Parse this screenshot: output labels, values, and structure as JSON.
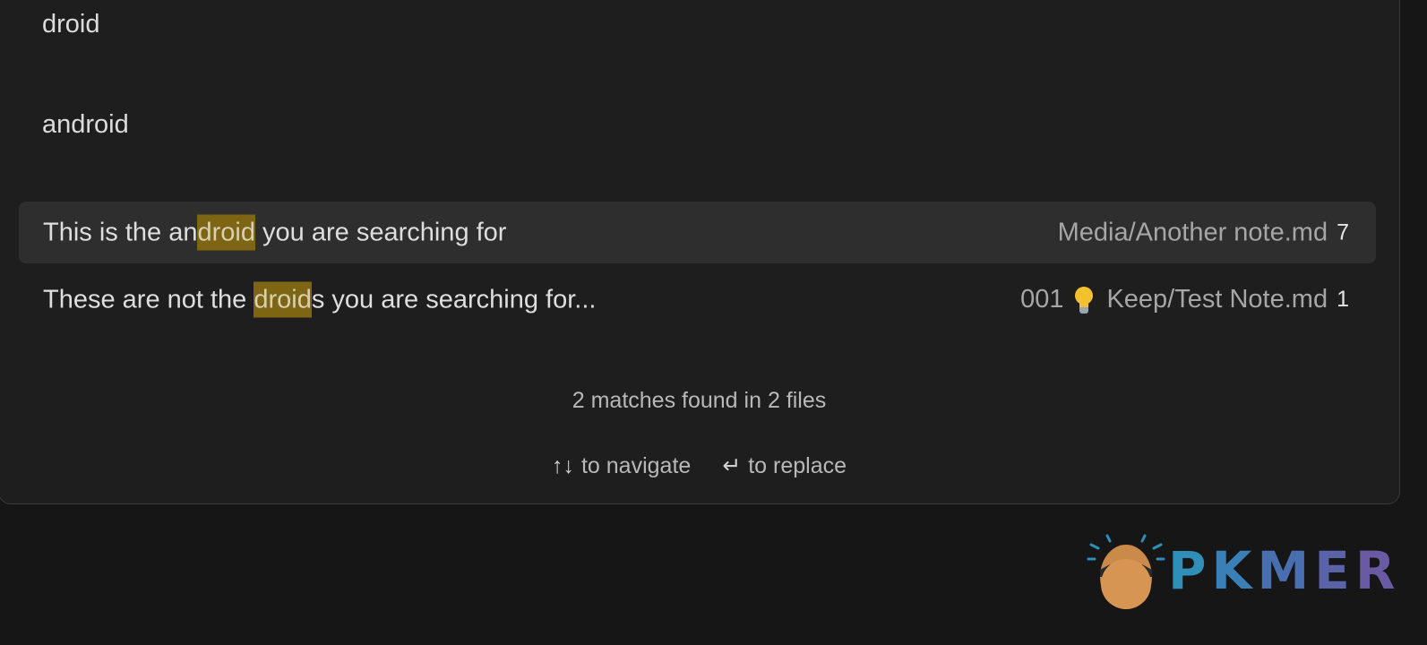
{
  "find_field": {
    "value": "droid"
  },
  "replace_field": {
    "value": "android"
  },
  "results": [
    {
      "before": "This is the an",
      "match": "droid",
      "after": " you are searching for",
      "file_prefix": "",
      "file_path": "Media/Another note.md",
      "line": "7",
      "selected": true
    },
    {
      "before": "These are not the ",
      "match": "droid",
      "after": "s you are searching for...",
      "file_prefix": "001",
      "file_icon": "lightbulb-icon",
      "file_path": "Keep/Test Note.md",
      "line": "1",
      "selected": false
    }
  ],
  "summary": "2 matches found in 2 files",
  "hints": {
    "navigate_keys": "↑↓",
    "navigate_label": "to navigate",
    "replace_key": "↵",
    "replace_label": "to replace"
  },
  "logo": {
    "text": "PKMER"
  },
  "colors": {
    "background": "#161616",
    "panel": "#1e1e1e",
    "selected_row": "#2e2e2e",
    "highlight": "#7d6514",
    "logo_blue": "#2f8fb8",
    "logo_purple": "#6a5aa4"
  }
}
